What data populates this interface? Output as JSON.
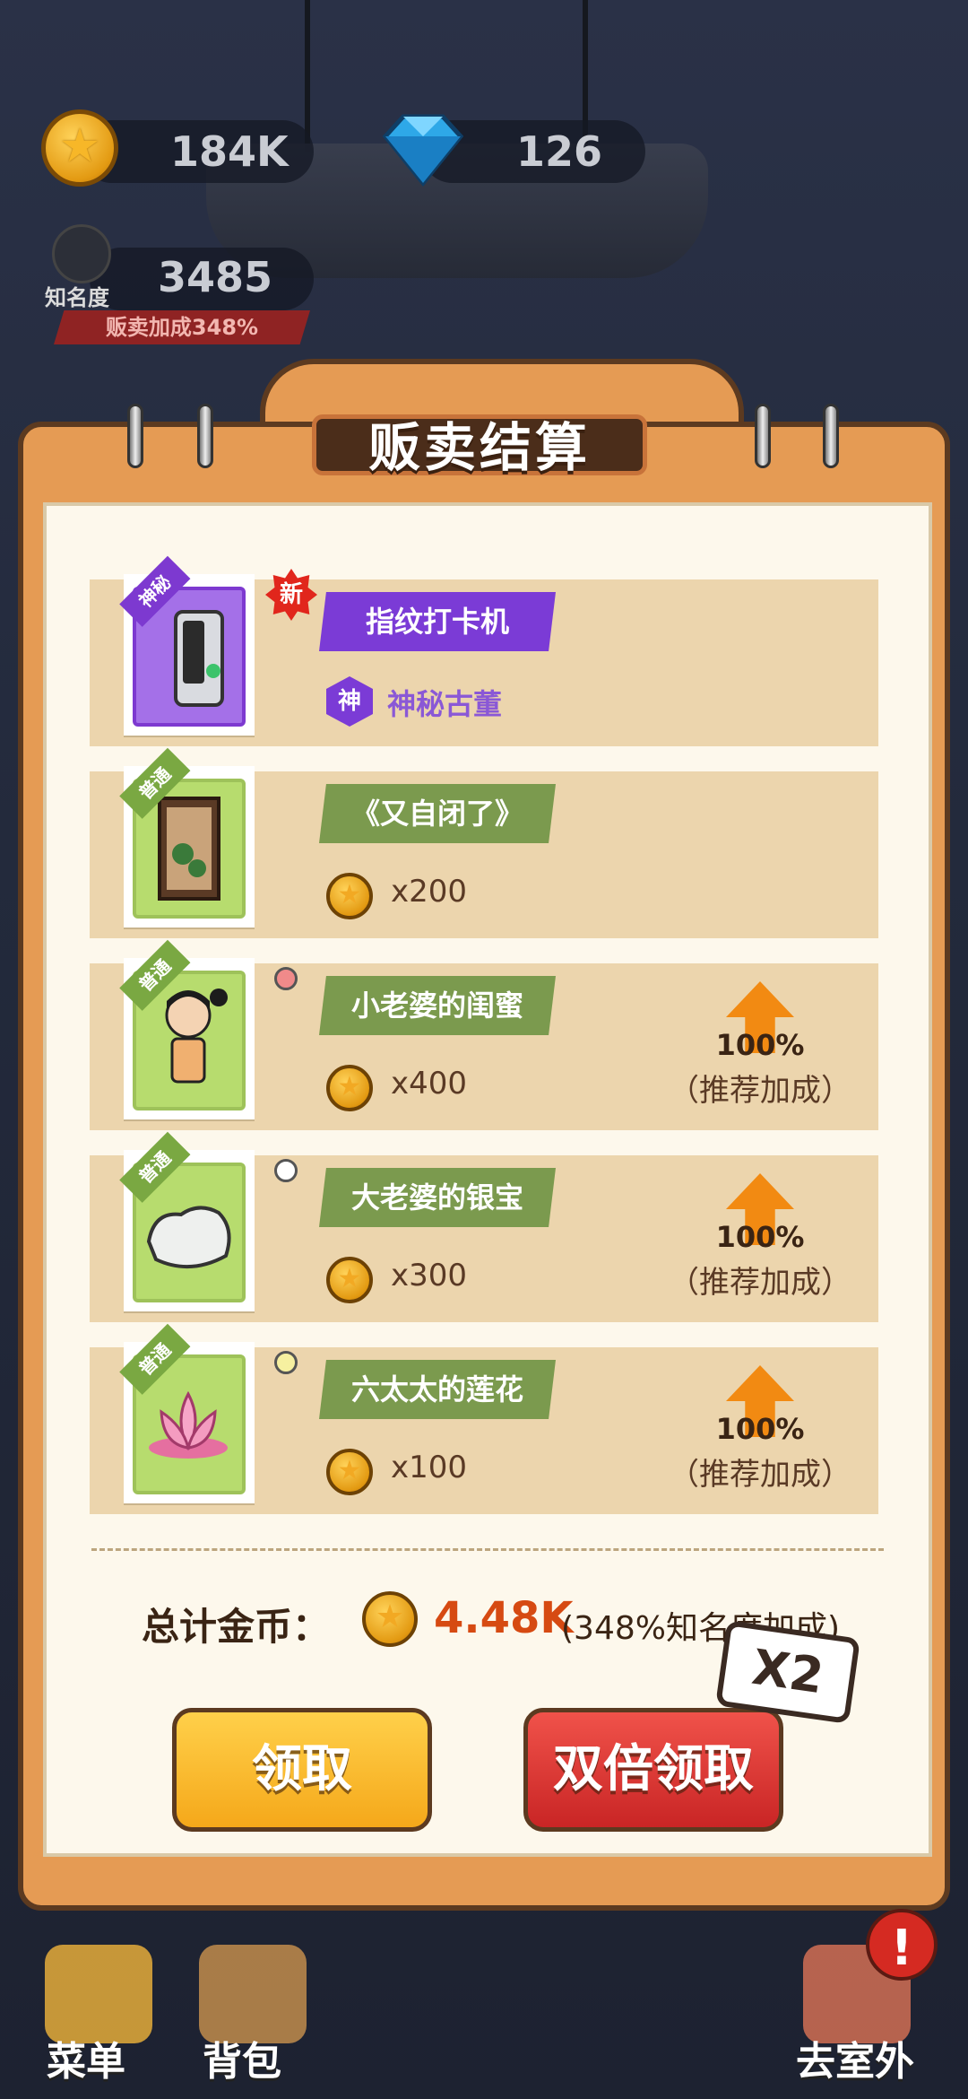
{
  "hud": {
    "coins": "184K",
    "gems": "126",
    "fame_label": "知名度",
    "fame": "3485",
    "sell_bonus": "贩卖加成348%"
  },
  "dialog": {
    "title": "贩卖结算",
    "items": [
      {
        "rarity_tag": "神秘",
        "name": "指纹打卡机",
        "is_new": true,
        "new_label": "新",
        "rarity_icon": "神",
        "rarity_text": "神秘古董",
        "icon": "fingerprint-clock-icon"
      },
      {
        "rarity_tag": "普通",
        "name": "《又自闭了》",
        "qty": "x200",
        "icon": "painting-icon"
      },
      {
        "rarity_tag": "普通",
        "name": "小老婆的闺蜜",
        "qty": "x400",
        "boost_pct": "100%",
        "boost_label": "（推荐加成）",
        "icon": "girl-figure-icon"
      },
      {
        "rarity_tag": "普通",
        "name": "大老婆的银宝",
        "qty": "x300",
        "boost_pct": "100%",
        "boost_label": "（推荐加成）",
        "icon": "silver-ingot-icon"
      },
      {
        "rarity_tag": "普通",
        "name": "六太太的莲花",
        "qty": "x100",
        "boost_pct": "100%",
        "boost_label": "（推荐加成）",
        "icon": "lotus-icon"
      }
    ],
    "total_label": "总计金币：",
    "total_value": "4.48K",
    "total_note": "(348%知名度加成)",
    "claim_button": "领取",
    "double_button": "双倍领取",
    "x2_badge": "X2"
  },
  "nav": {
    "menu": "菜单",
    "bag": "背包",
    "outside": "去室外",
    "alert": "!"
  },
  "colors": {
    "panel": "#e59b54",
    "common_tag": "#7aa842",
    "mystic_tag": "#7d39d0",
    "claim": "#f5a81a",
    "double": "#c92525"
  }
}
